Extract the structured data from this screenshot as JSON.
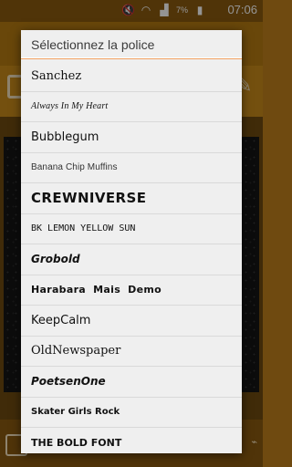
{
  "status_bar": {
    "battery": "7%",
    "time": "07:06",
    "icons": [
      "notification-mute-icon",
      "wifi-icon",
      "signal-icon",
      "battery-icon"
    ]
  },
  "dialog": {
    "title": "Sélectionnez la police",
    "fonts": [
      "Sanchez",
      "Always In My Heart",
      "Bubblegum",
      "Banana Chip Muffins",
      "CREWNIVERSE",
      "BK LEMON YELLOW SUN",
      "Grobold",
      "Harabara Mais Demo",
      "KeepCalm",
      "OldNewspaper",
      "PoetsenOne",
      "Skater Girls Rock",
      "THE BOLD FONT"
    ]
  },
  "colors": {
    "accent": "#f0a060",
    "background_app": "#b57a12",
    "dialog_bg": "#efefef"
  }
}
